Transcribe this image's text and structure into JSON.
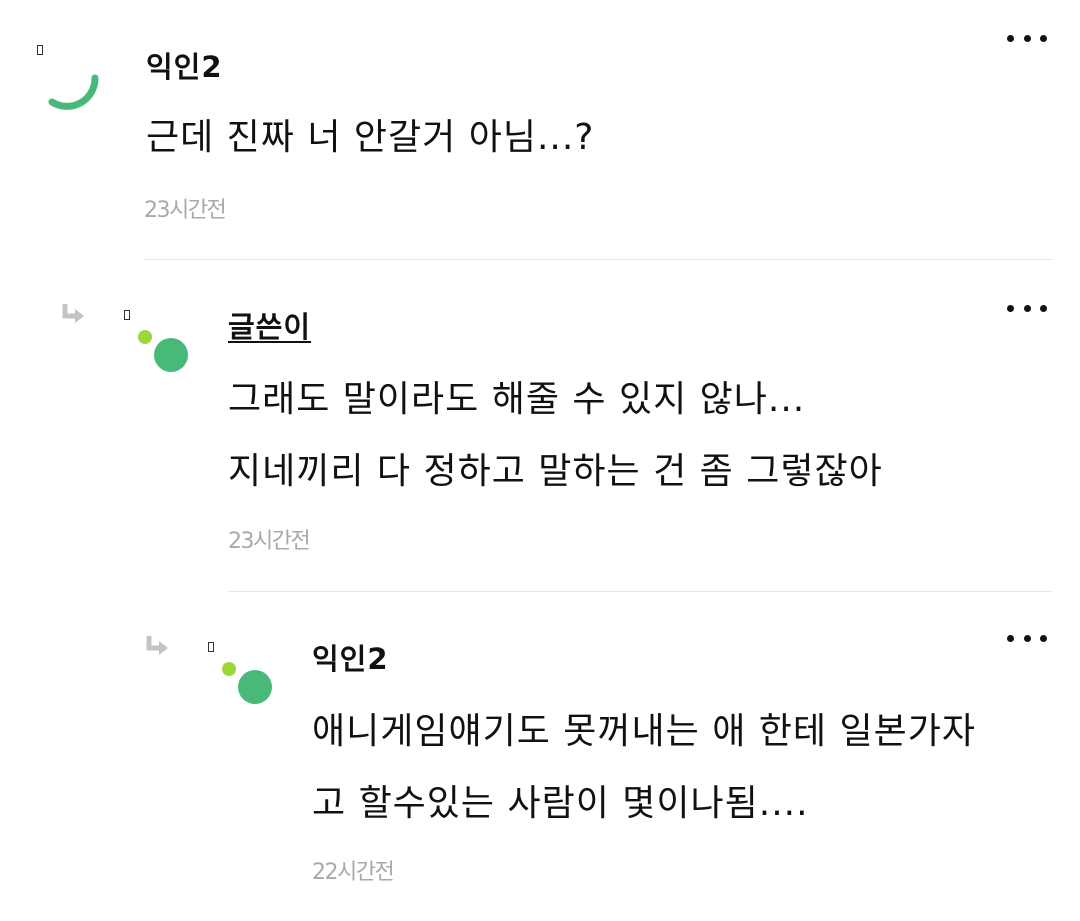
{
  "colors": {
    "accent_green": "#49b97a",
    "light_green": "#9bd83a",
    "timestamp": "#a9a9a9",
    "reply_arrow": "#c4c4c4"
  },
  "comments": [
    {
      "author": "익인2",
      "lines": [
        "근데 진짜 너 안갈거 아님...?"
      ],
      "time": "23시간전",
      "icons": {
        "avatar": "green-arc-avatar-icon",
        "more": "more-options-icon"
      }
    },
    {
      "author": "글쓴이",
      "lines": [
        "그래도 말이라도 해줄 수 있지 않나...",
        "지네끼리 다 정하고 말하는 건 좀 그렇잖아"
      ],
      "time": "23시간전",
      "icons": {
        "reply": "reply-arrow-icon",
        "avatar": "green-dots-avatar-icon",
        "more": "more-options-icon"
      }
    },
    {
      "author": "익인2",
      "lines": [
        "애니게임얘기도 못꺼내는 애 한테 일본가자",
        "고 할수있는 사람이 몇이나됨...."
      ],
      "time": "22시간전",
      "icons": {
        "reply": "reply-arrow-icon",
        "avatar": "green-dots-avatar-icon",
        "more": "more-options-icon"
      }
    }
  ]
}
